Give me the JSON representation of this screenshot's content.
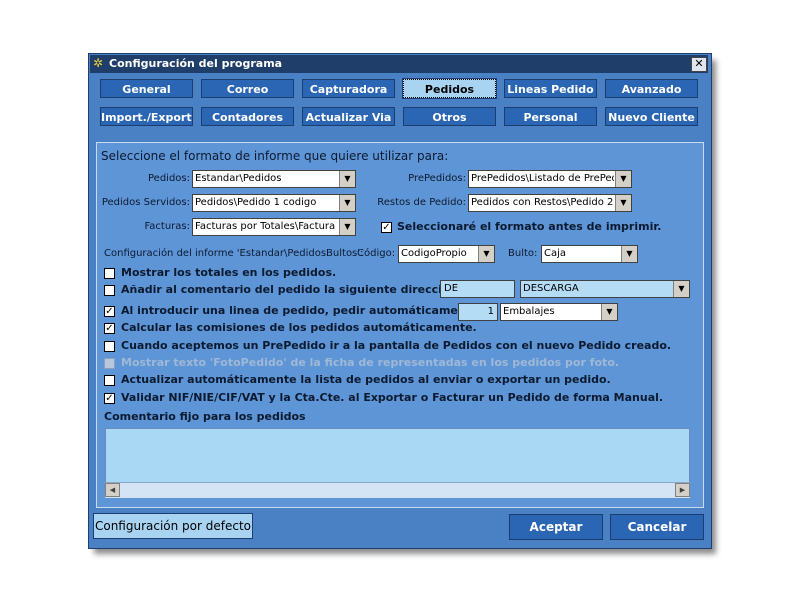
{
  "window": {
    "title": "Configuración del programa",
    "close_label": "✕"
  },
  "tabs_row1": [
    "General",
    "Correo",
    "Capturadora",
    "Pedidos",
    "Lineas Pedido",
    "Avanzado"
  ],
  "tabs_row2": [
    "Import./Export.",
    "Contadores",
    "Actualizar Via",
    "Otros",
    "Personal",
    "Nuevo Cliente"
  ],
  "active_tab": "Pedidos",
  "section_title": "Seleccione el formato de informe que quiere utilizar para:",
  "formats": {
    "pedidos_label": "Pedidos:",
    "pedidos_value": "Estandar\\Pedidos",
    "servidos_label": "Pedidos Servidos:",
    "servidos_value": "Pedidos\\Pedido 1 codigo",
    "facturas_label": "Facturas:",
    "facturas_value": "Facturas por Totales\\Factura",
    "prepedidos_label": "PrePedidos:",
    "prepedidos_value": "PrePedidos\\Listado de PrePed",
    "restos_label": "Restos de Pedido:",
    "restos_value": "Pedidos con Restos\\Pedido 2 c",
    "select_before_print_label": "Seleccionaré el formato antes de imprimir.",
    "select_before_print_checked": true
  },
  "bultos": {
    "info_label": "Configuración del informe 'Estandar\\PedidosBultos':",
    "codigo_label": "Código:",
    "codigo_value": "CodigoPropio",
    "bulto_label": "Bulto:",
    "bulto_value": "Caja"
  },
  "options": [
    {
      "label": "Mostrar los totales en los pedidos.",
      "checked": false,
      "disabled": false
    },
    {
      "label": "Añadir al comentario del pedido la siguiente dirección:",
      "checked": false,
      "disabled": false
    },
    {
      "label": "Al introducir una linea de pedido, pedir automáticamente:",
      "checked": true,
      "disabled": false
    },
    {
      "label": "Calcular las comisiones de los pedidos automáticamente.",
      "checked": true,
      "disabled": false
    },
    {
      "label": "Cuando aceptemos un PrePedido ir a la pantalla de Pedidos con el nuevo Pedido creado.",
      "checked": false,
      "disabled": false
    },
    {
      "label": "Mostrar texto 'FotoPedido' de la ficha de representadas en los pedidos por foto.",
      "checked": false,
      "disabled": true
    },
    {
      "label": "Actualizar automáticamente la lista de pedidos al enviar o exportar un pedido.",
      "checked": false,
      "disabled": false
    },
    {
      "label": "Validar NIF/NIE/CIF/VAT y la Cta.Cte. al Exportar o Facturar un Pedido de forma Manual.",
      "checked": true,
      "disabled": false
    }
  ],
  "address": {
    "prefix_value": "DE",
    "direction_value": "DESCARGA"
  },
  "auto_ask": {
    "quantity_value": "1",
    "unit_value": "Embalajes"
  },
  "comment": {
    "label": "Comentario fijo para los pedidos",
    "value": ""
  },
  "buttons": {
    "defaults": "Configuración por defecto",
    "accept": "Aceptar",
    "cancel": "Cancelar"
  },
  "colors": {
    "window_bg": "#4a80c4",
    "panel_bg": "#5e95d6",
    "tab_bg": "#2a66b4",
    "active_tab_bg": "#a8d4f2",
    "titlebar": "#1f3f6a"
  }
}
